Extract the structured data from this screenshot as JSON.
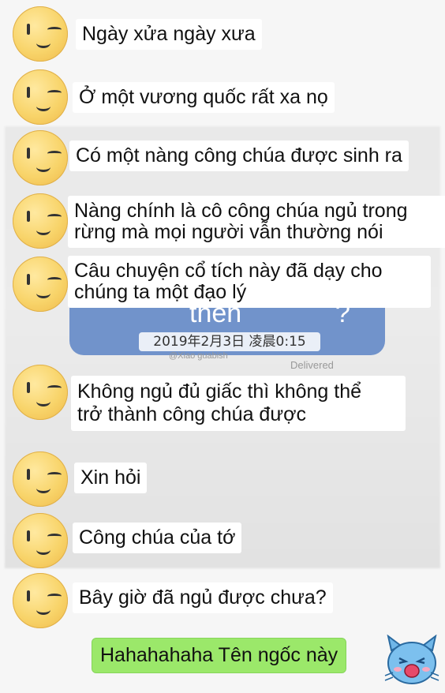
{
  "background": {
    "blue_bubble_text": "then",
    "blue_bubble_mark": "?",
    "timestamp": "2019年2月3日 凌晨0:15",
    "delivered": "Delivered",
    "watermark": "@Xiao guabish"
  },
  "messages": [
    {
      "text": "Ngày xửa ngày xưa"
    },
    {
      "text": "Ở một vương quốc rất xa nọ"
    },
    {
      "text": "Có một nàng công chúa được sinh ra"
    },
    {
      "line1": "Nàng chính là cô công chúa ngủ trong",
      "line2": "rừng mà mọi người vẫn thường nói"
    },
    {
      "line1": "Câu chuyện cổ tích này đã dạy cho",
      "line2": "chúng ta một đạo lý"
    },
    {
      "line1": "Không ngủ đủ giấc thì không thể",
      "line2": "trở thành công chúa được"
    },
    {
      "text": "Xin hỏi"
    },
    {
      "text": "Công chúa của tớ"
    },
    {
      "text": "Bây giờ đã ngủ được chưa?"
    }
  ],
  "reply": {
    "text": "Hahahahaha Tên ngốc này"
  },
  "colors": {
    "reply_bubble": "#9be86a",
    "incoming_bubble": "#ffffff",
    "avatar": "#f8d46a"
  }
}
